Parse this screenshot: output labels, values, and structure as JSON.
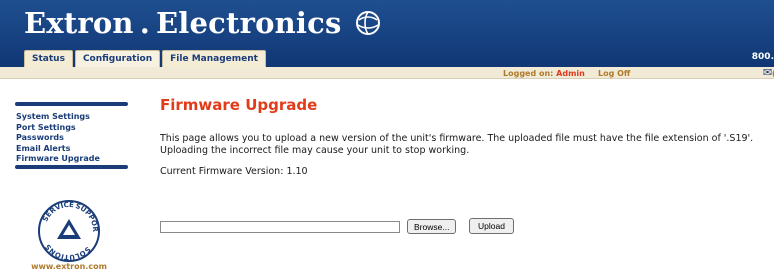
{
  "header": {
    "brand_left": "Extron",
    "brand_dot": ".",
    "brand_right": "Electronics",
    "brand_icon": "globe-logo",
    "tabs": [
      {
        "label": "Status"
      },
      {
        "label": "Configuration"
      },
      {
        "label": "File Management"
      }
    ],
    "phone_partial": "800."
  },
  "status_bar": {
    "logged_on_label": "Logged on:",
    "user": "Admin",
    "log_off": "Log Off",
    "mail_icon": "envelope-icon",
    "trailing_partial": "("
  },
  "sidebar": {
    "items": [
      {
        "label": "System Settings"
      },
      {
        "label": "Port Settings"
      },
      {
        "label": "Passwords"
      },
      {
        "label": "Email Alerts"
      },
      {
        "label": "Firmware Upgrade"
      }
    ],
    "seal_text_top": "SERVICE",
    "seal_text_right": "SUPPORT",
    "seal_text_bottom": "SOLUTIONS",
    "website": "www.extron.com"
  },
  "main": {
    "title": "Firmware Upgrade",
    "description_line1": "This page allows you to upload a new version of the unit's firmware. The uploaded file must have the file extension of '.S19'.",
    "description_line2": "Uploading the incorrect file may cause your unit to stop working.",
    "current_version_label": "Current Firmware Version:",
    "current_version": "1.10",
    "browse_label": "Browse...",
    "upload_label": "Upload",
    "file_value": ""
  },
  "colors": {
    "header_blue": "#164080",
    "accent_red": "#e23b1a",
    "gold": "#b07a2b",
    "tab_bg": "#f5ecd6"
  }
}
